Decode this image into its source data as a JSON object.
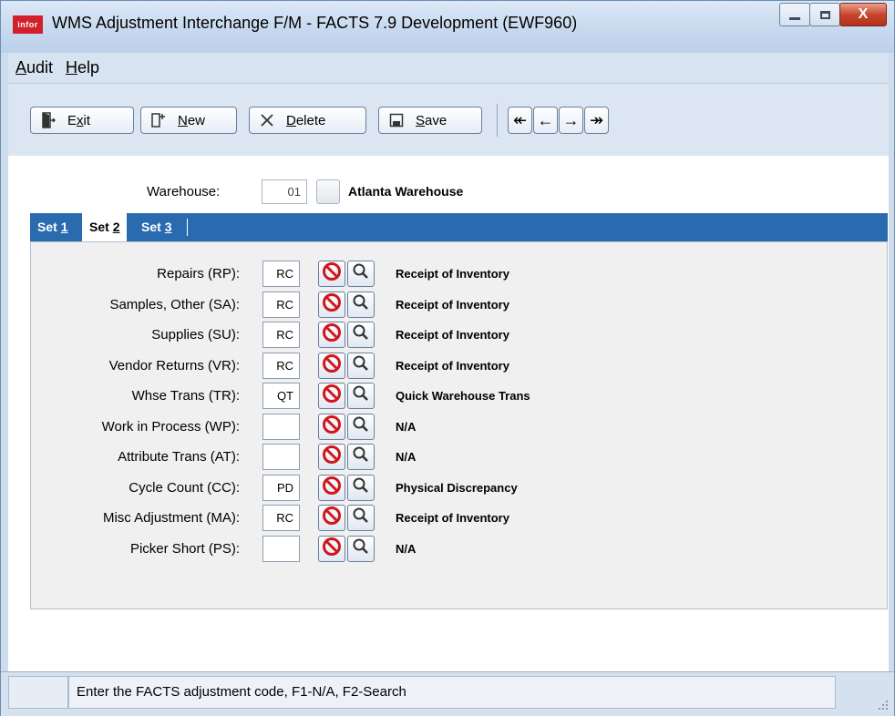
{
  "window": {
    "logo_text": "infor",
    "title": "WMS Adjustment Interchange F/M - FACTS 7.9 Development (EWF960)",
    "close_label": "X"
  },
  "menu": {
    "items": [
      {
        "hotkey": "A",
        "rest": "udit"
      },
      {
        "hotkey": "H",
        "rest": "elp"
      }
    ]
  },
  "toolbar": {
    "exit": {
      "pre": "E",
      "hotkey": "x",
      "post": "it"
    },
    "new": {
      "pre": "",
      "hotkey": "N",
      "post": "ew"
    },
    "delete": {
      "pre": "",
      "hotkey": "D",
      "post": "elete"
    },
    "save": {
      "pre": "",
      "hotkey": "S",
      "post": "ave"
    }
  },
  "header": {
    "warehouse_label": "Warehouse:",
    "warehouse_value": "01",
    "warehouse_desc": "Atlanta Warehouse"
  },
  "tabs": [
    {
      "pre": "Set ",
      "hotkey": "1",
      "active": false
    },
    {
      "pre": "Set ",
      "hotkey": "2",
      "active": true
    },
    {
      "pre": "Set ",
      "hotkey": "3",
      "active": false
    }
  ],
  "rows": [
    {
      "label": "Repairs (RP):",
      "value": "RC",
      "desc": "Receipt of Inventory"
    },
    {
      "label": "Samples, Other (SA):",
      "value": "RC",
      "desc": "Receipt of Inventory"
    },
    {
      "label": "Supplies (SU):",
      "value": "RC",
      "desc": "Receipt of Inventory"
    },
    {
      "label": "Vendor Returns (VR):",
      "value": "RC",
      "desc": "Receipt of Inventory"
    },
    {
      "label": "Whse Trans (TR):",
      "value": "QT",
      "desc": "Quick Warehouse Trans"
    },
    {
      "label": "Work in Process (WP):",
      "value": "",
      "desc": "N/A"
    },
    {
      "label": "Attribute Trans (AT):",
      "value": "",
      "desc": "N/A"
    },
    {
      "label": "Cycle Count (CC):",
      "value": "PD",
      "desc": "Physical Discrepancy"
    },
    {
      "label": "Misc Adjustment (MA):",
      "value": "RC",
      "desc": "Receipt of Inventory"
    },
    {
      "label": "Picker Short (PS):",
      "value": "",
      "desc": "N/A"
    }
  ],
  "status": {
    "message": "Enter the FACTS adjustment code, F1-N/A, F2-Search"
  },
  "icons": {
    "na": "no-entry-icon",
    "search": "magnifier-icon",
    "nav": [
      "first-record-icon",
      "prev-record-icon",
      "next-record-icon",
      "last-record-icon"
    ]
  },
  "colors": {
    "tab_bar": "#2a6bb0",
    "na_icon": "#d0161b"
  }
}
